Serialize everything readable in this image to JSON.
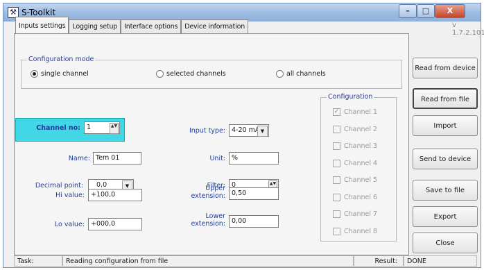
{
  "window": {
    "title": "S-Toolkit",
    "version": "v 1.7.2.101"
  },
  "tabs": [
    "Inputs settings",
    "Logging setup",
    "Interface options",
    "Device information"
  ],
  "config_mode": {
    "title": "Configuration mode",
    "options": [
      "single channel",
      "selected channels",
      "all channels"
    ],
    "selected": "single channel"
  },
  "fields": {
    "channel_no": {
      "label": "Channel no:",
      "value": "1"
    },
    "name": {
      "label": "Name:",
      "value": "Tem 01"
    },
    "decimal_point": {
      "label": "Decimal point:",
      "value": "0,0"
    },
    "hi_value": {
      "label": "Hi value:",
      "value": "+100,0"
    },
    "lo_value": {
      "label": "Lo value:",
      "value": "+000,0"
    },
    "input_type": {
      "label": "Input type:",
      "value": "4-20 mA"
    },
    "unit": {
      "label": "Unit:",
      "value": "%"
    },
    "filter": {
      "label": "Filter:",
      "value": "0"
    },
    "upper_ext": {
      "label1": "Upper",
      "label2": "extension:",
      "value": "0,50"
    },
    "lower_ext": {
      "label1": "Lower",
      "label2": "extension:",
      "value": "0,00"
    }
  },
  "configuration": {
    "title": "Configuration",
    "channels": [
      {
        "label": "Channel 1",
        "checked": true
      },
      {
        "label": "Channel 2",
        "checked": false
      },
      {
        "label": "Channel 3",
        "checked": false
      },
      {
        "label": "Channel 4",
        "checked": false
      },
      {
        "label": "Channel 5",
        "checked": false
      },
      {
        "label": "Channel 6",
        "checked": false
      },
      {
        "label": "Channel 7",
        "checked": false
      },
      {
        "label": "Channel 8",
        "checked": false
      }
    ]
  },
  "buttons": {
    "read_device": "Read from device",
    "read_file": "Read from file",
    "import": "Import",
    "send_device": "Send to device",
    "save_file": "Save to file",
    "export": "Export",
    "close": "Close"
  },
  "status": {
    "task_label": "Task:",
    "task_value": "Reading configuration from file",
    "result_label": "Result:",
    "result_value": "DONE"
  },
  "glyphs": {
    "min": "–",
    "max": "□",
    "close": "X",
    "check": "✓",
    "spin": "▲▼",
    "combo": "▼"
  }
}
